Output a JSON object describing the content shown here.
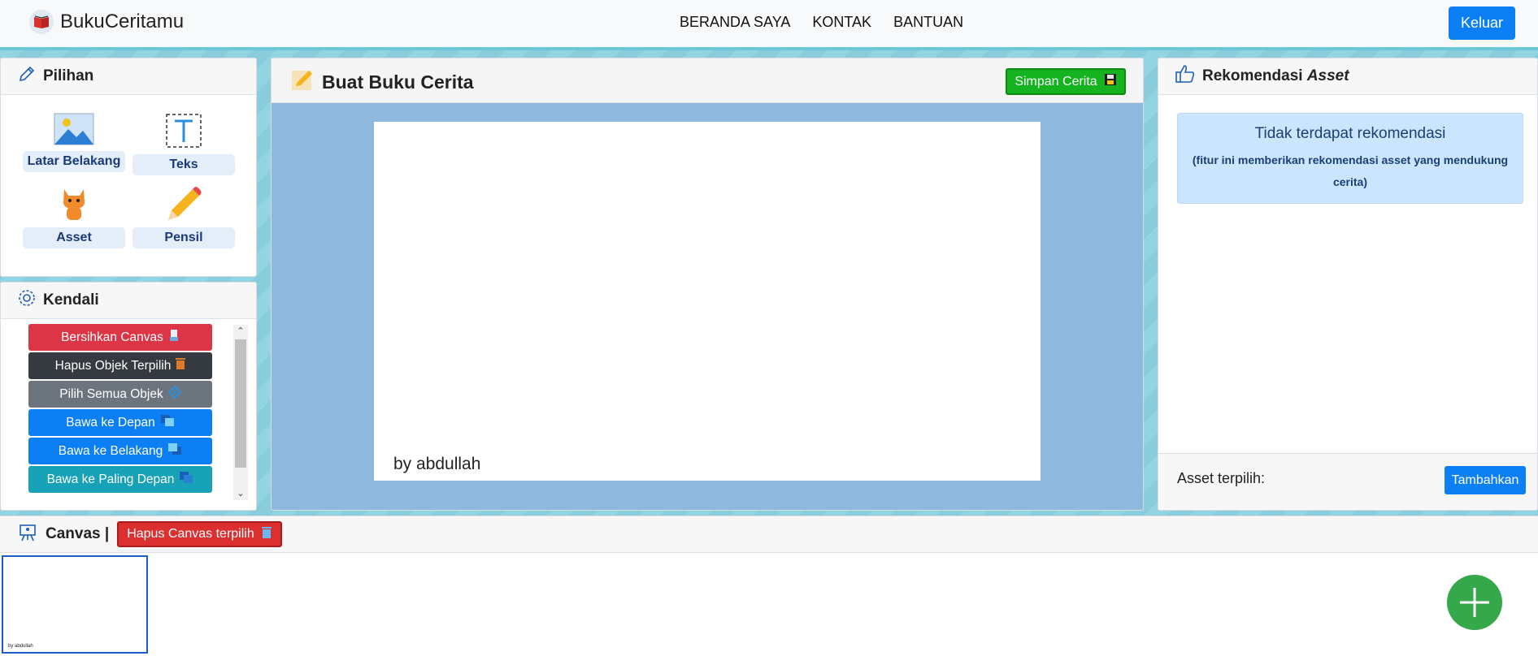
{
  "navbar": {
    "brand": "BukuCeritamu",
    "links": [
      "BERANDA SAYA",
      "KONTAK",
      "BANTUAN"
    ],
    "logout_label": "Keluar"
  },
  "pilihan": {
    "title": "Pilihan",
    "tools": [
      {
        "label": "Latar Belakang",
        "icon": "image-icon"
      },
      {
        "label": "Teks",
        "icon": "text-icon"
      },
      {
        "label": "Asset",
        "icon": "cat-icon"
      },
      {
        "label": "Pensil",
        "icon": "pencil-icon"
      }
    ]
  },
  "kendali": {
    "title": "Kendali",
    "buttons": [
      {
        "label": "Bersihkan Canvas",
        "color": "#dc3545",
        "icon": "broom-icon"
      },
      {
        "label": "Hapus Objek Terpilih",
        "color": "#343a40",
        "icon": "trash-icon"
      },
      {
        "label": "Pilih Semua Objek",
        "color": "#6c757d",
        "icon": "select-all-icon"
      },
      {
        "label": "Bawa ke Depan",
        "color": "#0d7ff5",
        "icon": "bring-forward-icon"
      },
      {
        "label": "Bawa ke Belakang",
        "color": "#0d7ff5",
        "icon": "send-backward-icon"
      },
      {
        "label": "Bawa ke Paling Depan",
        "color": "#17a2b8",
        "icon": "bring-to-front-icon"
      }
    ]
  },
  "editor": {
    "title": "Buat Buku Cerita",
    "save_label": "Simpan Cerita",
    "canvas_text": "by abdullah"
  },
  "rekomendasi": {
    "title_plain": "Rekomendasi",
    "title_italic": "Asset",
    "empty_title": "Tidak terdapat rekomendasi",
    "empty_sub": "(fitur ini memberikan rekomendasi asset yang mendukung cerita)",
    "selected_label": "Asset terpilih:",
    "add_label": "Tambahkan"
  },
  "canvas_bar": {
    "title": "Canvas |",
    "delete_label": "Hapus Canvas terpilih",
    "thumb_text": "by abdullah"
  },
  "colors": {
    "accent": "#0d7ff5",
    "save": "#14b31f",
    "danger": "#dc2f2f",
    "fab": "#34a84a"
  }
}
